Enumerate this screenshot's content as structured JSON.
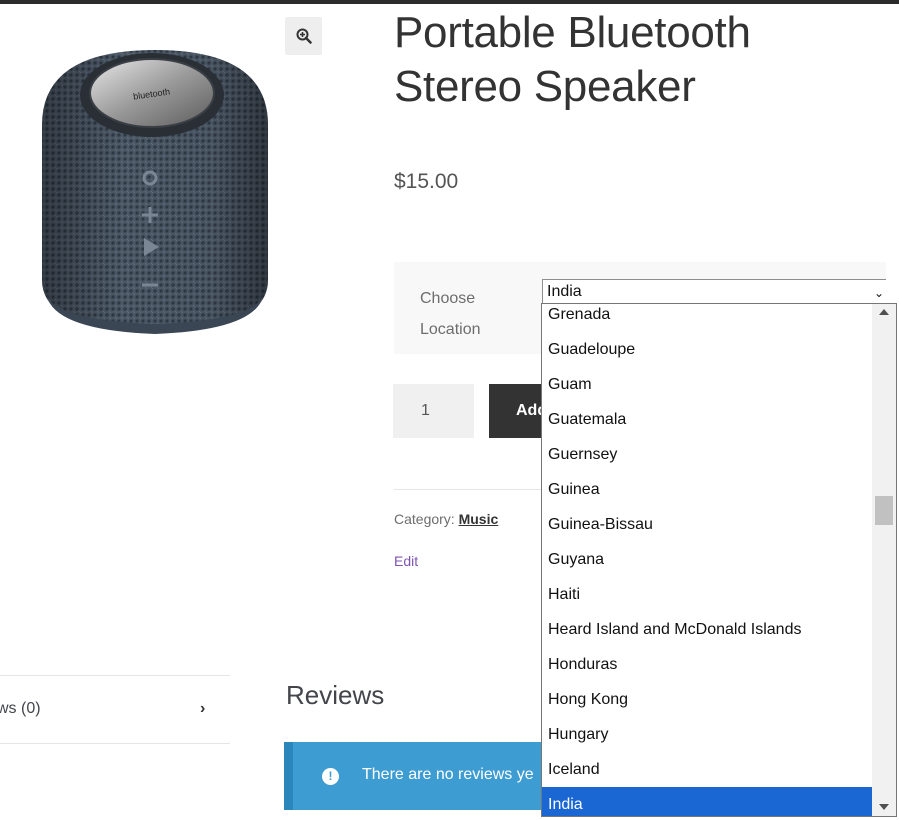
{
  "product": {
    "title": "Portable Bluetooth Stereo Speaker",
    "price": "$15.00",
    "image_alt": "bluetooth-speaker-image"
  },
  "variations": {
    "label": "Choose Location",
    "selected_value": "India"
  },
  "cart": {
    "quantity": "1",
    "add_to_cart_label": "Add to cart",
    "add_to_cart_visible": "Add"
  },
  "meta": {
    "category_label": "Category:",
    "category_value": "Music",
    "edit_label": "Edit"
  },
  "tabs": {
    "reviews_label": "ws (0)"
  },
  "reviews": {
    "heading": "Reviews",
    "notice_text": "There are no reviews ye"
  },
  "dropdown": {
    "options": [
      "Grenada",
      "Guadeloupe",
      "Guam",
      "Guatemala",
      "Guernsey",
      "Guinea",
      "Guinea-Bissau",
      "Guyana",
      "Haiti",
      "Heard Island and McDonald Islands",
      "Honduras",
      "Hong Kong",
      "Hungary",
      "Iceland",
      "India"
    ],
    "selected": "India"
  },
  "colors": {
    "accent_blue": "#1a66d2",
    "notice_blue": "#3d9cd2",
    "button_dark": "#333333",
    "edit_purple": "#7f54b3"
  },
  "icons": {
    "zoom": "zoom-in-icon",
    "chevron": "chevron-right-icon",
    "notice": "info-icon"
  }
}
